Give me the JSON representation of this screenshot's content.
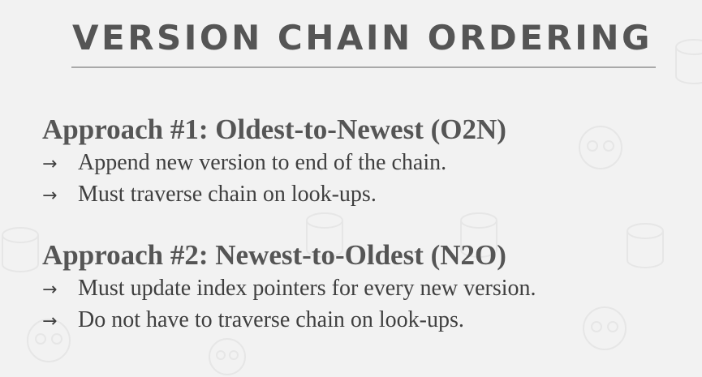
{
  "title": "VERSION CHAIN ORDERING",
  "sections": [
    {
      "heading": "Approach #1: Oldest-to-Newest (O2N)",
      "bullets": [
        "Append new version to end of the chain.",
        "Must traverse chain on look-ups."
      ]
    },
    {
      "heading": "Approach #2: Newest-to-Oldest (N2O)",
      "bullets": [
        "Must update index pointers for every new version.",
        "Do not have to traverse chain on look-ups."
      ]
    }
  ],
  "bullet_arrow": "→",
  "colors": {
    "background": "#f2f2f2",
    "title": "#555555",
    "rule": "#a9a9a9",
    "heading": "#555555",
    "body_text": "#3f3f3f"
  }
}
